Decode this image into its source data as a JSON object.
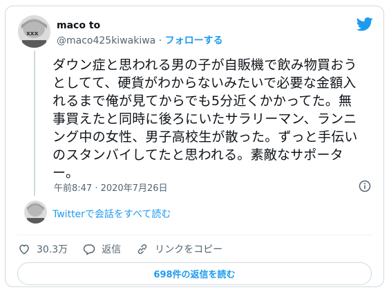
{
  "author": {
    "display_name": "maco to",
    "handle": "@maco425kiwakiwa",
    "separator": "·",
    "follow_label": "フォローする"
  },
  "tweet": {
    "text": "ダウン症と思われる男の子が自販機で飲み物買おう\nとしてて、硬貨がわからないみたいで必要な金額入\nれるまで俺が見てからでも5分近くかかってた。無\n事買えたと同時に後ろにいたサラリーマン、ランニ\nング中の女性、男子高校生が散った。ずっと手伝い\nのスタンバイしてたと思われる。素敵なサポータ\nー。",
    "timestamp": "午前8:47 · 2020年7月26日"
  },
  "thread": {
    "read_all_label": "Twitterで会話をすべて読む"
  },
  "actions": {
    "like_count": "30.3万",
    "reply_label": "返信",
    "copy_link_label": "リンクをコピー"
  },
  "replies_button": {
    "label": "698件の返信を読む"
  },
  "icons": {
    "brand": "twitter-bird-icon",
    "info": "info-icon",
    "like": "heart-icon",
    "reply": "reply-bubble-icon",
    "link": "link-icon"
  },
  "colors": {
    "accent": "#1d9bf0",
    "text": "#0f1419",
    "secondary": "#536471",
    "border": "#cfd9de"
  }
}
